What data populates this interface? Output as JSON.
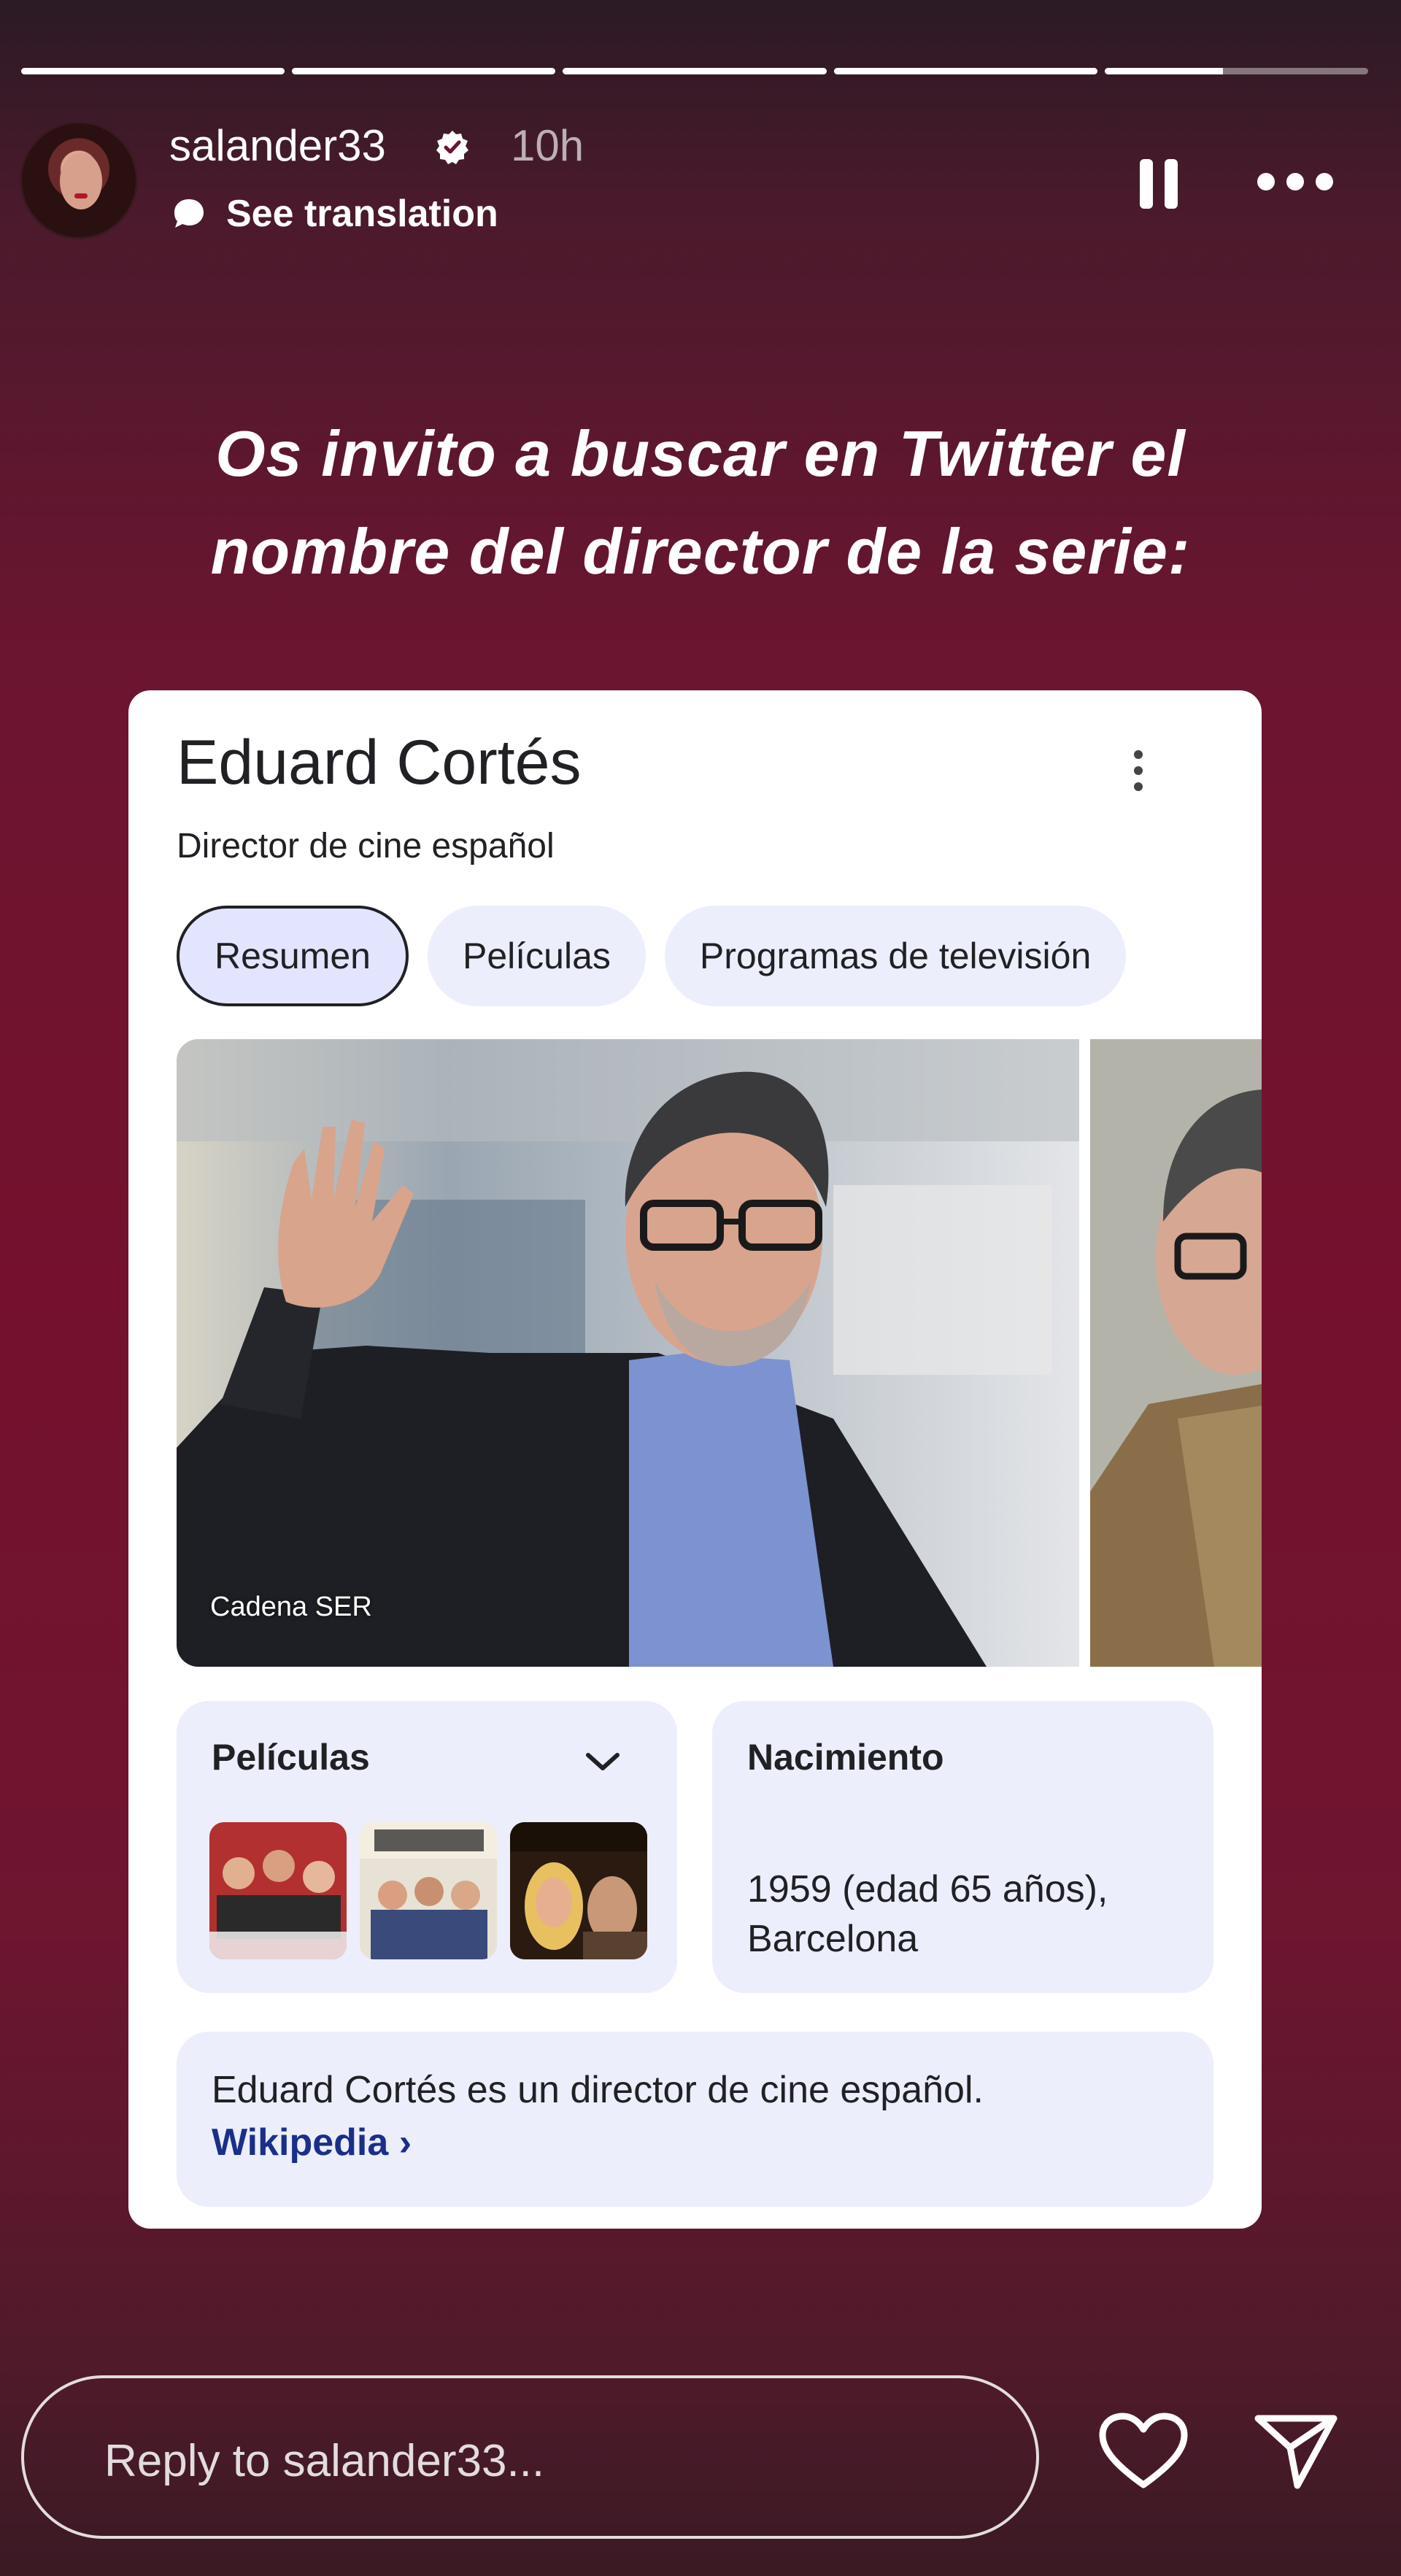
{
  "story": {
    "segments": [
      1,
      1,
      1,
      1,
      0.45
    ],
    "username": "salander33",
    "time": "10h",
    "see_translation": "See translation",
    "headline_line1": "Os invito a buscar en Twitter el",
    "headline_line2": "nombre del director de la serie:"
  },
  "card": {
    "title": "Eduard Cortés",
    "subtitle": "Director de cine español",
    "chips": [
      "Resumen",
      "Películas",
      "Programas de televisión"
    ],
    "active_chip": "Resumen",
    "photo_credit": "Cadena SER",
    "films_label": "Películas",
    "birth_label": "Nacimiento",
    "birth_value_line1": "1959 (edad 65 años),",
    "birth_value_line2": "Barcelona",
    "description": "Eduard Cortés es un director de cine español.",
    "source_link": "Wikipedia ›"
  },
  "reply": {
    "placeholder": "Reply to salander33..."
  },
  "icons": {
    "verified": "verified-badge-icon",
    "translate": "speech-bubble-icon",
    "pause": "pause-icon",
    "more": "more-horizontal-icon",
    "kebab": "more-vertical-icon",
    "chevron": "chevron-down-icon",
    "heart": "heart-icon",
    "send": "send-icon"
  },
  "colors": {
    "background": "#75112e",
    "card": "#ffffff",
    "chip_bg": "#eceefb",
    "active_chip_bg": "#e3e5ff",
    "link": "#1a2f8a"
  }
}
